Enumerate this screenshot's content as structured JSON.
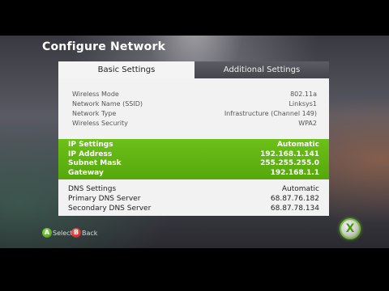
{
  "title": "Configure Network",
  "tabs": {
    "basic": "Basic Settings",
    "additional": "Additional Settings"
  },
  "wireless": [
    {
      "label": "Wireless Mode",
      "value": "802.11a"
    },
    {
      "label": "Network Name (SSID)",
      "value": "Linksys1"
    },
    {
      "label": "Network Type",
      "value": "Infrastructure (Channel 149)"
    },
    {
      "label": "Wireless Security",
      "value": "WPA2"
    }
  ],
  "ip": [
    {
      "label": "IP Settings",
      "value": "Automatic"
    },
    {
      "label": "IP Address",
      "value": "192.168.1.141"
    },
    {
      "label": "Subnet Mask",
      "value": "255.255.255.0"
    },
    {
      "label": "Gateway",
      "value": "192.168.1.1"
    }
  ],
  "dns": [
    {
      "label": "DNS Settings",
      "value": "Automatic"
    },
    {
      "label": "Primary DNS Server",
      "value": "68.87.76.182"
    },
    {
      "label": "Secondary DNS Server",
      "value": "68.87.78.134"
    }
  ],
  "footer": {
    "a_glyph": "A",
    "select": "Select",
    "b_glyph": "B",
    "back": "Back"
  },
  "logo": {
    "glyph": "X"
  },
  "colors": {
    "accent_green": "#5fb410",
    "panel": "#f2f2f2"
  }
}
